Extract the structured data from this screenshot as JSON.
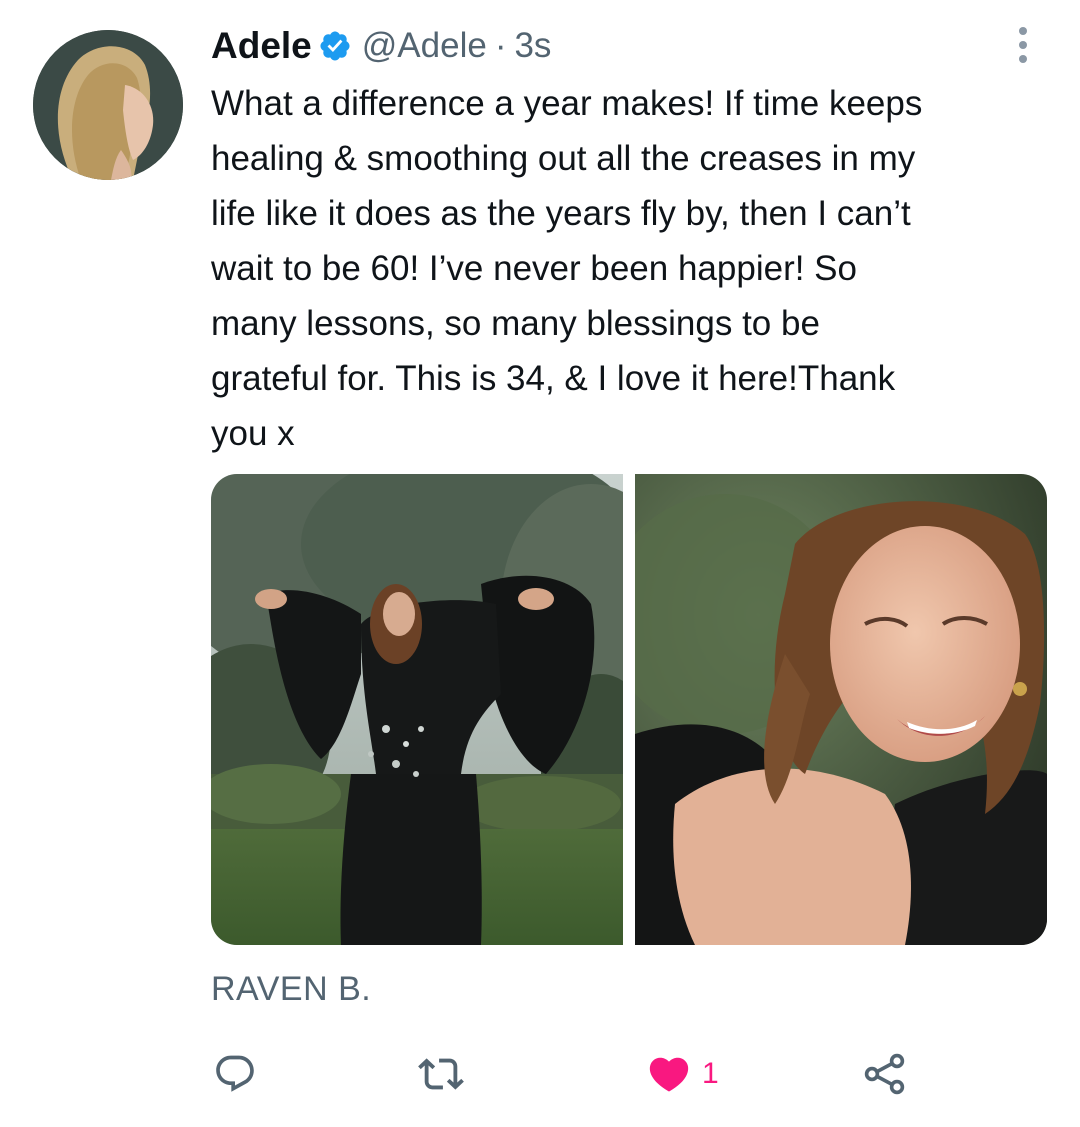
{
  "tweet": {
    "author_name": "Adele",
    "handle": "@Adele",
    "separator": "·",
    "time": "3s",
    "text_lines": [
      "What a difference a year makes! If time keeps",
      "healing & smoothing out all the creases in my",
      "life like it does as the years fly by, then I can’t",
      "wait to be 60! I’ve never been happier! So",
      "many lessons, so many blessings to be",
      "grateful for. This is 34, & I love it here!Thank",
      "you x"
    ],
    "photo_credit": "RAVEN B."
  },
  "actions": {
    "reply_icon": "reply-icon",
    "retweet_icon": "retweet-icon",
    "like_icon": "heart-filled-icon",
    "like_count": "1",
    "share_icon": "share-icon"
  },
  "colors": {
    "verified": "#1d9bf0",
    "like": "#f91880",
    "secondary_text": "#536471",
    "primary_text": "#0f1419"
  }
}
